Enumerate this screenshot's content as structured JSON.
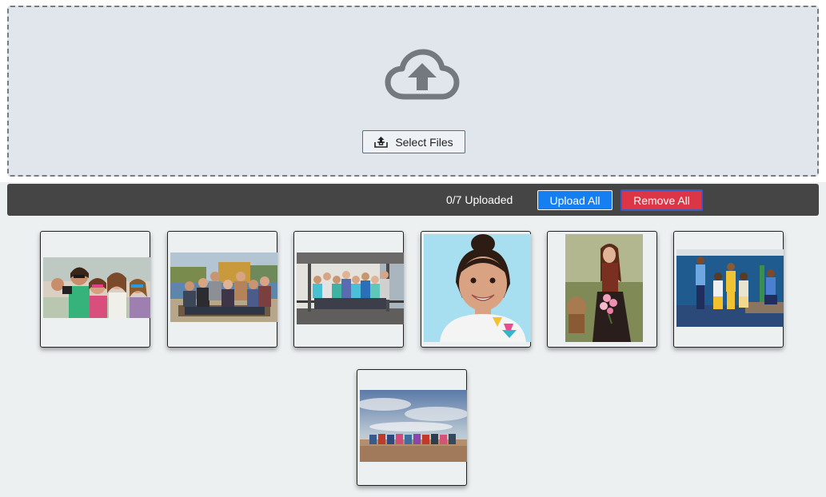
{
  "dropzone": {
    "icon": "cloud-upload-icon",
    "select_button": {
      "label": "Select Files",
      "icon": "upload-tray-icon"
    }
  },
  "status_bar": {
    "status_text": "0/7 Uploaded",
    "upload_all_label": "Upload All",
    "remove_all_label": "Remove All"
  },
  "files": [
    {
      "preview": "group-selfie-photo"
    },
    {
      "preview": "friends-on-bench-photo"
    },
    {
      "preview": "group-on-porch-photo"
    },
    {
      "preview": "smiling-girl-portrait-photo"
    },
    {
      "preview": "girl-with-flowers-photo"
    },
    {
      "preview": "office-team-photo"
    },
    {
      "preview": "friends-on-beach-photo"
    }
  ],
  "colors": {
    "dropzone_bg": "#e1e5ec",
    "status_bar_bg": "#454545",
    "upload_button": "#157ff2",
    "remove_button": "#dc3545",
    "page_bg": "#ecf0f1"
  }
}
